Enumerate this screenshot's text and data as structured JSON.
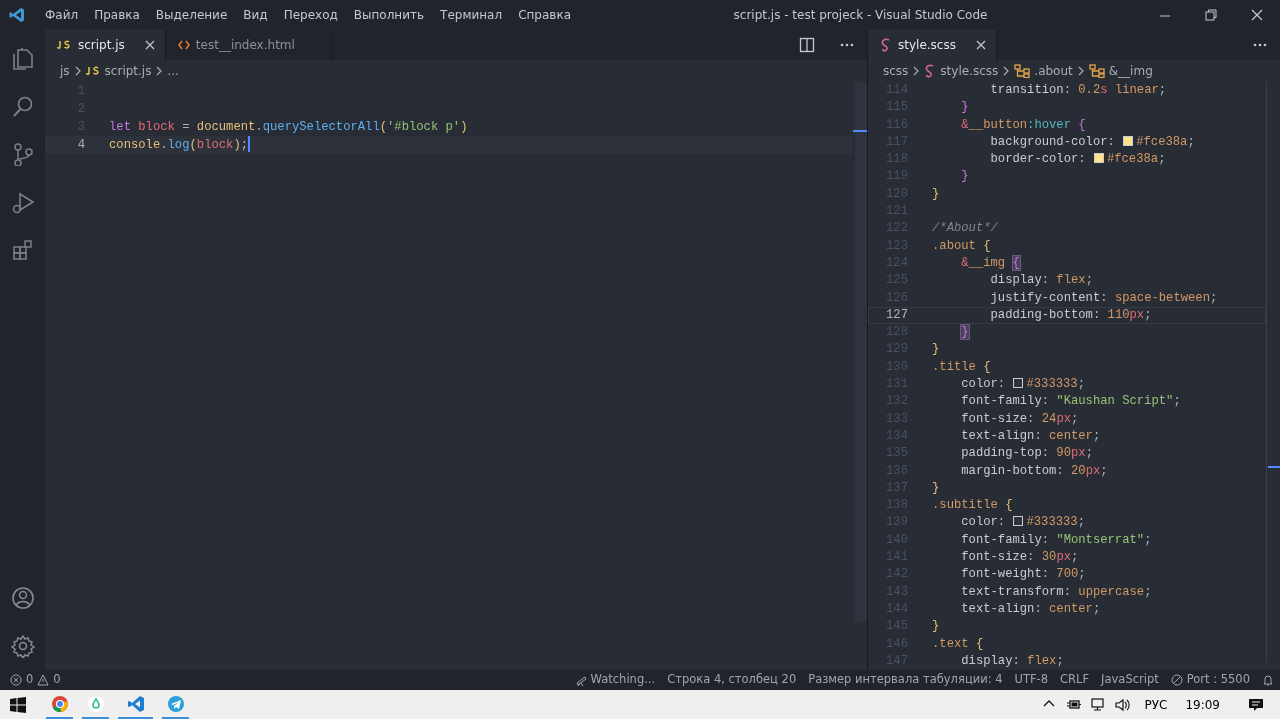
{
  "window": {
    "title": "script.js - test projeck - Visual Studio Code"
  },
  "menu": [
    "Файл",
    "Правка",
    "Выделение",
    "Вид",
    "Переход",
    "Выполнить",
    "Терминал",
    "Справка"
  ],
  "activity_bar": [
    {
      "kind": "files",
      "selected": false
    },
    {
      "kind": "search",
      "selected": false
    },
    {
      "kind": "source-control",
      "selected": false
    },
    {
      "kind": "run",
      "selected": false
    },
    {
      "kind": "extensions",
      "selected": false
    }
  ],
  "activity_bottom": [
    {
      "kind": "account"
    },
    {
      "kind": "settings"
    }
  ],
  "left_editor": {
    "tabs": [
      {
        "label": "script.js",
        "kind": "js",
        "selected": true
      },
      {
        "label": "test__index.html",
        "kind": "html",
        "selected": false
      }
    ],
    "breadcrumb": [
      {
        "label": "js",
        "kind": "folder"
      },
      {
        "label": "script.js",
        "kind": "js"
      },
      {
        "label": "...",
        "kind": "more"
      }
    ],
    "lines": [
      {
        "number": "1",
        "cursor": false
      },
      {
        "number": "2",
        "cursor": false
      },
      {
        "number": "3",
        "cursor": false,
        "text": "let block = document.querySelectorAll('#block p')"
      },
      {
        "number": "4",
        "cursor": true,
        "text": "console.log(block);"
      }
    ]
  },
  "right_editor": {
    "tabs": [
      {
        "label": "style.scss",
        "kind": "scss",
        "selected": true
      }
    ],
    "breadcrumb": [
      {
        "label": "scss",
        "kind": "folder"
      },
      {
        "label": "style.scss",
        "kind": "scss"
      },
      {
        "label": ".about",
        "kind": "selector"
      },
      {
        "label": "&__img",
        "kind": "selector"
      }
    ],
    "lines": [
      {
        "number": "114",
        "current": false,
        "text": "        transition: 0.2s linear;"
      },
      {
        "number": "115",
        "current": false,
        "text": "    }"
      },
      {
        "number": "116",
        "current": false,
        "text": "    &__button:hover {"
      },
      {
        "number": "117",
        "current": false,
        "text": "        background-color: #fce38a;",
        "color": "#fce38a"
      },
      {
        "number": "118",
        "current": false,
        "text": "        border-color: #fce38a;",
        "color": "#fce38a"
      },
      {
        "number": "119",
        "current": false,
        "text": "    }"
      },
      {
        "number": "120",
        "current": false,
        "text": "}"
      },
      {
        "number": "121",
        "current": false
      },
      {
        "number": "122",
        "current": false,
        "text": "/*About*/"
      },
      {
        "number": "123",
        "current": false,
        "text": ".about {"
      },
      {
        "number": "124",
        "current": false,
        "text": "    &__img {"
      },
      {
        "number": "125",
        "current": false,
        "text": "        display: flex;"
      },
      {
        "number": "126",
        "current": false,
        "text": "        justify-content: space-between;"
      },
      {
        "number": "127",
        "current": true,
        "text": "        padding-bottom: 110px;"
      },
      {
        "number": "128",
        "current": false,
        "text": "    }"
      },
      {
        "number": "129",
        "current": false,
        "text": "}"
      },
      {
        "number": "130",
        "current": false,
        "text": ".title {"
      },
      {
        "number": "131",
        "current": false,
        "text": "    color: #333333;",
        "color": "#333333"
      },
      {
        "number": "132",
        "current": false,
        "text": "    font-family: \"Kaushan Script\";"
      },
      {
        "number": "133",
        "current": false,
        "text": "    font-size: 24px;"
      },
      {
        "number": "134",
        "current": false,
        "text": "    text-align: center;"
      },
      {
        "number": "135",
        "current": false,
        "text": "    padding-top: 90px;"
      },
      {
        "number": "136",
        "current": false,
        "text": "    margin-bottom: 20px;"
      },
      {
        "number": "137",
        "current": false,
        "text": "}"
      },
      {
        "number": "138",
        "current": false,
        "text": ".subtitle {"
      },
      {
        "number": "139",
        "current": false,
        "text": "    color: #333333;",
        "color": "#333333"
      },
      {
        "number": "140",
        "current": false,
        "text": "    font-family: \"Montserrat\";"
      },
      {
        "number": "141",
        "current": false,
        "text": "    font-size: 30px;"
      },
      {
        "number": "142",
        "current": false,
        "text": "    font-weight: 700;"
      },
      {
        "number": "143",
        "current": false,
        "text": "    text-transform: uppercase;"
      },
      {
        "number": "144",
        "current": false,
        "text": "    text-align: center;"
      },
      {
        "number": "145",
        "current": false,
        "text": "}"
      },
      {
        "number": "146",
        "current": false,
        "text": ".text {"
      },
      {
        "number": "147",
        "current": false,
        "text": "    display: flex;"
      }
    ]
  },
  "status_bar": {
    "left": [
      {
        "kind": "errors",
        "label": "0"
      },
      {
        "kind": "warnings",
        "label": "0"
      }
    ],
    "right": [
      {
        "kind": "watch",
        "label": "Watching..."
      },
      {
        "kind": "text",
        "label": "Строка 4, столбец 20"
      },
      {
        "kind": "text",
        "label": "Размер интервала табуляции: 4"
      },
      {
        "kind": "text",
        "label": "UTF-8"
      },
      {
        "kind": "text",
        "label": "CRLF"
      },
      {
        "kind": "text",
        "label": "JavaScript"
      },
      {
        "kind": "port",
        "label": "Port : 5500"
      },
      {
        "kind": "bell"
      }
    ]
  },
  "taskbar": {
    "apps": [
      {
        "kind": "chrome",
        "running": true
      },
      {
        "kind": "app",
        "running": true
      },
      {
        "kind": "vscode",
        "running": true
      },
      {
        "kind": "telegram",
        "running": true
      }
    ],
    "language": "РУС",
    "time": "19:09"
  }
}
